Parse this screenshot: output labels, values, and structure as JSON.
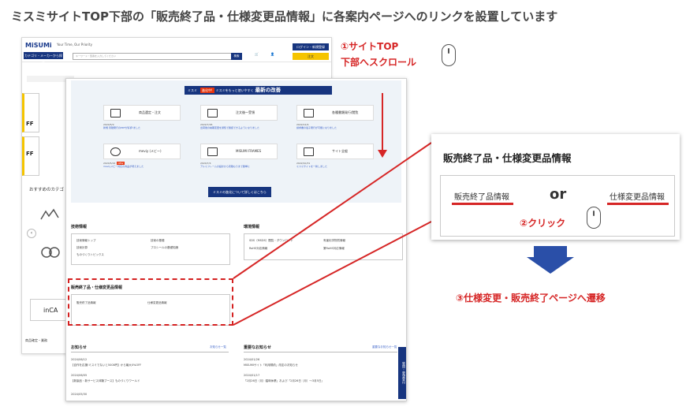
{
  "page_title": "ミスミサイトTOP下部の「販売終了品・仕様変更品情報」に各案内ページへのリンクを設置しています",
  "site": {
    "logo": "MiSUMi",
    "tagline": "Your Time, Our Priority",
    "category_button": "カテゴリ・メーカーから探す",
    "search_placeholder": "キーワード・型番を入力してください",
    "search_button": "検索",
    "login_button": "ログイン・新規登録",
    "order_button": "注文",
    "ff_label": "FF",
    "recommend_heading": "おすすめのカテゴ",
    "product_label": "商品確定・業務",
    "inca_label": "inCA"
  },
  "improvements": {
    "banner_pill": "進化中!",
    "banner_prefix": "ミスミ",
    "banner_mid": "ミスミをもっと使いやすく",
    "banner_title": "最新の改善",
    "cards": [
      {
        "label": "商品選定・注文",
        "date": "2024/5/9",
        "desc": "新規 見積発行のPDFが好評!ました"
      },
      {
        "label": "注文後〜受領",
        "date": "2022/7/26",
        "desc": "出荷後の納期変更を通知で確認できるようになりました"
      },
      {
        "label": "各種書類発行/閲覧",
        "date": "2022/12/9",
        "desc": "請求書の電子発行が可能になりました"
      },
      {
        "label": "meviy (メビー)",
        "date": "2024/5/22",
        "desc": "meviyメビー対応の商品が増えました",
        "new": "NEW"
      },
      {
        "label": "MISUMI FRAMES",
        "date": "2024/7/4",
        "desc": "アルミフレームの設計から見積もりまで簡単に"
      },
      {
        "label": "サイト全般",
        "date": "2022/10/31",
        "desc": "ミスミサイトを一新しました"
      }
    ],
    "more_button": "ミスミの進化について詳しくはこちら"
  },
  "tech": {
    "title": "技術情報",
    "links": [
      "技術情報トップ",
      "技術計算",
      "技術の基礎",
      "プロシールの基礎知識",
      "ものづくりトピックス"
    ]
  },
  "env": {
    "title": "環境情報",
    "links": [
      "SDS（MSDS）閲覧・ダウンロード",
      "RoHS対応情報",
      "有害化学物質情報",
      "第RoHS対応情報"
    ]
  },
  "discontinued": {
    "title": "販売終了品・仕様変更品情報",
    "link1": "販売終了品情報",
    "link2": "仕様変更品情報"
  },
  "notices": {
    "title": "お知らせ",
    "more": "お知らせ一覧",
    "items": [
      {
        "date": "2024/06/12",
        "text": "【自作を応援!ミスミでないと5008円】から最大0%OFF"
      },
      {
        "date": "2024/06/05",
        "text": "【新製品・新サービス体験ブース】ものづくりワールド"
      },
      {
        "date": "2024/05/30",
        "text": ""
      }
    ]
  },
  "important": {
    "title": "重要なお知らせ",
    "more": "重要なお知らせ一覧",
    "items": [
      {
        "date": "2024/01/26",
        "text": "MISUMIサイト「利用規約」改定のお知らせ"
      },
      {
        "date": "2024/01/17",
        "text": "「2月26日（月）臨時休業」および「2月26日（月）〜3月5日」"
      }
    ]
  },
  "side_tab": "質問・要望受付",
  "annotations": {
    "step1_line1": "①サイトTOP",
    "step1_line2": "下部へスクロール",
    "step2": "②クリック",
    "step3": "③仕様変更・販売終了ページへ遷移",
    "zoom_title": "販売終了品・仕様変更品情報",
    "zoom_link1": "販売終了品情報",
    "zoom_link2": "仕様変更品情報",
    "or": "or"
  },
  "colors": {
    "accent_red": "#d62626",
    "brand_navy": "#17357f",
    "arrow_blue": "#2a4fa8",
    "yellow": "#f5c400"
  }
}
